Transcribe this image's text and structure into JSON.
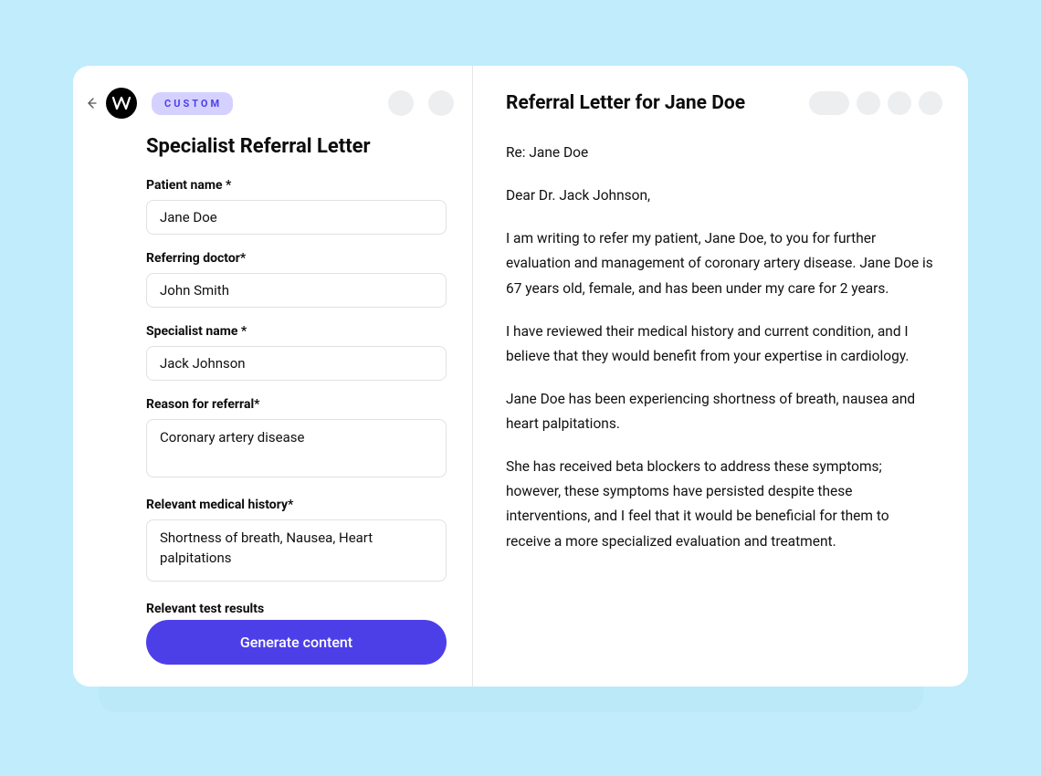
{
  "badge": "CUSTOM",
  "form": {
    "title": "Specialist Referral Letter",
    "patient_label": "Patient name *",
    "patient_value": "Jane Doe",
    "doctor_label": "Referring doctor*",
    "doctor_value": "John Smith",
    "specialist_label": "Specialist name *",
    "specialist_value": "Jack Johnson",
    "reason_label": "Reason for referral*",
    "reason_value": "Coronary artery disease",
    "history_label": "Relevant medical history*",
    "history_value": "Shortness of breath, Nausea, Heart palpitations",
    "tests_label": "Relevant test results",
    "generate_label": "Generate content"
  },
  "output": {
    "title": "Referral Letter for Jane Doe",
    "re": "Re: Jane Doe",
    "greeting": "Dear Dr. Jack Johnson,",
    "p1": "I am writing to refer my patient, Jane Doe, to you for further evaluation and management of coronary artery disease. Jane Doe is 67 years old, female, and has been under my care for 2 years.",
    "p2": "I have reviewed their medical history and current condition, and I believe that they would benefit from your expertise in cardiology.",
    "p3": "Jane Doe has been experiencing shortness of breath, nausea and heart palpitations.",
    "p4": "She has received beta blockers to address these symptoms; however, these symptoms have persisted despite these interventions, and I feel that it would be beneficial for them to receive a more specialized evaluation and treatment."
  }
}
